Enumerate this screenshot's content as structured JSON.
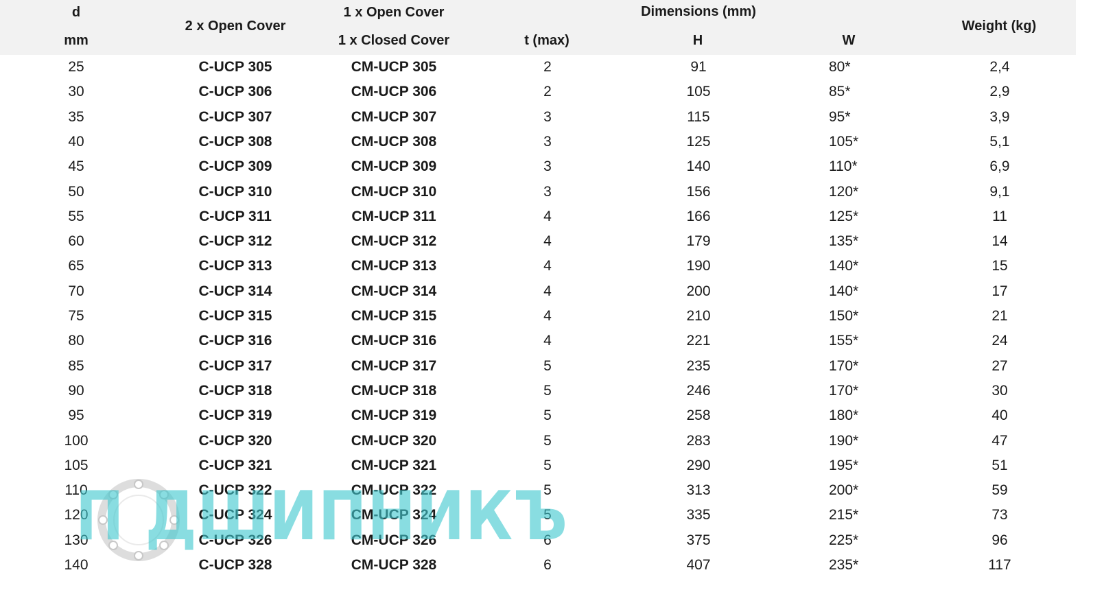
{
  "header": {
    "d_label": "d",
    "d_unit": "mm",
    "open_cover_col": "2 x Open Cover",
    "mixed_cover_line1": "1 x Open Cover",
    "mixed_cover_line2": "1 x Closed Cover",
    "dimensions_group": "Dimensions (mm)",
    "t_label": "t (max)",
    "h_label": "H",
    "w_label": "W",
    "weight_label": "Weight (kg)"
  },
  "rows": [
    {
      "d": "25",
      "open": "C-UCP 305",
      "mixed": "CM-UCP 305",
      "t": "2",
      "h": "91",
      "w": "80*",
      "kg": "2,4"
    },
    {
      "d": "30",
      "open": "C-UCP 306",
      "mixed": "CM-UCP 306",
      "t": "2",
      "h": "105",
      "w": "85*",
      "kg": "2,9"
    },
    {
      "d": "35",
      "open": "C-UCP 307",
      "mixed": "CM-UCP 307",
      "t": "3",
      "h": "115",
      "w": "95*",
      "kg": "3,9"
    },
    {
      "d": "40",
      "open": "C-UCP 308",
      "mixed": "CM-UCP 308",
      "t": "3",
      "h": "125",
      "w": "105*",
      "kg": "5,1"
    },
    {
      "d": "45",
      "open": "C-UCP 309",
      "mixed": "CM-UCP 309",
      "t": "3",
      "h": "140",
      "w": "110*",
      "kg": "6,9"
    },
    {
      "d": "50",
      "open": "C-UCP 310",
      "mixed": "CM-UCP 310",
      "t": "3",
      "h": "156",
      "w": "120*",
      "kg": "9,1"
    },
    {
      "d": "55",
      "open": "C-UCP 311",
      "mixed": "CM-UCP 311",
      "t": "4",
      "h": "166",
      "w": "125*",
      "kg": "11"
    },
    {
      "d": "60",
      "open": "C-UCP 312",
      "mixed": "CM-UCP 312",
      "t": "4",
      "h": "179",
      "w": "135*",
      "kg": "14"
    },
    {
      "d": "65",
      "open": "C-UCP 313",
      "mixed": "CM-UCP 313",
      "t": "4",
      "h": "190",
      "w": "140*",
      "kg": "15"
    },
    {
      "d": "70",
      "open": "C-UCP 314",
      "mixed": "CM-UCP 314",
      "t": "4",
      "h": "200",
      "w": "140*",
      "kg": "17"
    },
    {
      "d": "75",
      "open": "C-UCP 315",
      "mixed": "CM-UCP 315",
      "t": "4",
      "h": "210",
      "w": "150*",
      "kg": "21"
    },
    {
      "d": "80",
      "open": "C-UCP 316",
      "mixed": "CM-UCP 316",
      "t": "4",
      "h": "221",
      "w": "155*",
      "kg": "24"
    },
    {
      "d": "85",
      "open": "C-UCP 317",
      "mixed": "CM-UCP 317",
      "t": "5",
      "h": "235",
      "w": "170*",
      "kg": "27"
    },
    {
      "d": "90",
      "open": "C-UCP 318",
      "mixed": "CM-UCP 318",
      "t": "5",
      "h": "246",
      "w": "170*",
      "kg": "30"
    },
    {
      "d": "95",
      "open": "C-UCP 319",
      "mixed": "CM-UCP 319",
      "t": "5",
      "h": "258",
      "w": "180*",
      "kg": "40"
    },
    {
      "d": "100",
      "open": "C-UCP 320",
      "mixed": "CM-UCP 320",
      "t": "5",
      "h": "283",
      "w": "190*",
      "kg": "47"
    },
    {
      "d": "105",
      "open": "C-UCP 321",
      "mixed": "CM-UCP 321",
      "t": "5",
      "h": "290",
      "w": "195*",
      "kg": "51"
    },
    {
      "d": "110",
      "open": "C-UCP 322",
      "mixed": "CM-UCP 322",
      "t": "5",
      "h": "313",
      "w": "200*",
      "kg": "59"
    },
    {
      "d": "120",
      "open": "C-UCP 324",
      "mixed": "CM-UCP 324",
      "t": "5",
      "h": "335",
      "w": "215*",
      "kg": "73"
    },
    {
      "d": "130",
      "open": "C-UCP 326",
      "mixed": "CM-UCP 326",
      "t": "6",
      "h": "375",
      "w": "225*",
      "kg": "96"
    },
    {
      "d": "140",
      "open": "C-UCP 328",
      "mixed": "CM-UCP 328",
      "t": "6",
      "h": "407",
      "w": "235*",
      "kg": "117"
    }
  ],
  "watermark": {
    "text": "П  ДШИПНИКЪ",
    "color": "#40c8ce",
    "icon": "bearing-ring-icon"
  },
  "colors": {
    "header_background": "#f2f2f2",
    "text": "#1a1a1a"
  }
}
